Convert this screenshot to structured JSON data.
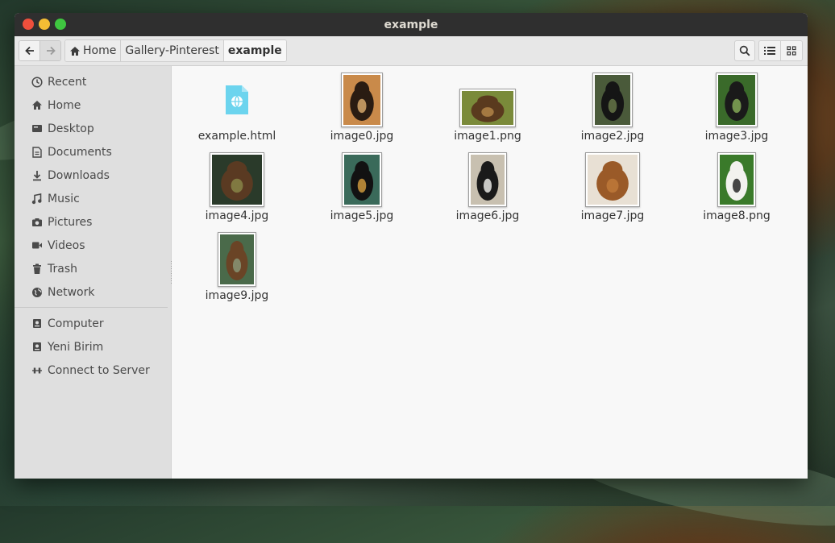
{
  "window": {
    "title": "example"
  },
  "toolbar": {
    "back_icon": "arrow-left-icon",
    "forward_icon": "arrow-right-icon",
    "breadcrumbs": [
      "Home",
      "Gallery-Pinterest",
      "example"
    ],
    "search_icon": "search-icon",
    "list_view_icon": "list-view-icon",
    "grid_view_icon": "grid-view-icon"
  },
  "sidebar": {
    "places": [
      {
        "label": "Recent",
        "icon": "clock-icon"
      },
      {
        "label": "Home",
        "icon": "home-icon"
      },
      {
        "label": "Desktop",
        "icon": "desktop-icon"
      },
      {
        "label": "Documents",
        "icon": "document-icon"
      },
      {
        "label": "Downloads",
        "icon": "download-icon"
      },
      {
        "label": "Music",
        "icon": "music-icon"
      },
      {
        "label": "Pictures",
        "icon": "camera-icon"
      },
      {
        "label": "Videos",
        "icon": "video-icon"
      },
      {
        "label": "Trash",
        "icon": "trash-icon"
      },
      {
        "label": "Network",
        "icon": "globe-icon"
      }
    ],
    "devices": [
      {
        "label": "Computer",
        "icon": "drive-icon"
      },
      {
        "label": "Yeni Birim",
        "icon": "drive-icon"
      },
      {
        "label": "Connect to Server",
        "icon": "server-connect-icon"
      }
    ]
  },
  "files": [
    {
      "name": "example.html",
      "type": "html"
    },
    {
      "name": "image0.jpg",
      "type": "image",
      "colors": [
        "#c98a4a",
        "#2a1c12",
        "#e0b070"
      ]
    },
    {
      "name": "image1.png",
      "type": "image",
      "colors": [
        "#7a8a3a",
        "#5a3a1e",
        "#b88a4a"
      ]
    },
    {
      "name": "image2.jpg",
      "type": "image",
      "colors": [
        "#4a5a3a",
        "#151515",
        "#6a7a4a"
      ]
    },
    {
      "name": "image3.jpg",
      "type": "image",
      "colors": [
        "#3a6a2a",
        "#1a1a1a",
        "#8ab05a"
      ]
    },
    {
      "name": "image4.jpg",
      "type": "image",
      "colors": [
        "#2a3a2a",
        "#5a3a22",
        "#8a8a4a"
      ]
    },
    {
      "name": "image5.jpg",
      "type": "image",
      "colors": [
        "#3a6a5a",
        "#121212",
        "#d8a040"
      ]
    },
    {
      "name": "image6.jpg",
      "type": "image",
      "colors": [
        "#c8c0b0",
        "#1a1a1a",
        "#f4f4f0"
      ]
    },
    {
      "name": "image7.jpg",
      "type": "image",
      "colors": [
        "#e8e0d4",
        "#9a5a28",
        "#c07a3a"
      ]
    },
    {
      "name": "image8.png",
      "type": "image",
      "colors": [
        "#3a7a2a",
        "#f2f2ee",
        "#1a1a1a"
      ]
    },
    {
      "name": "image9.jpg",
      "type": "image",
      "colors": [
        "#4a6a4a",
        "#6a4426",
        "#8a9a7a"
      ]
    }
  ]
}
